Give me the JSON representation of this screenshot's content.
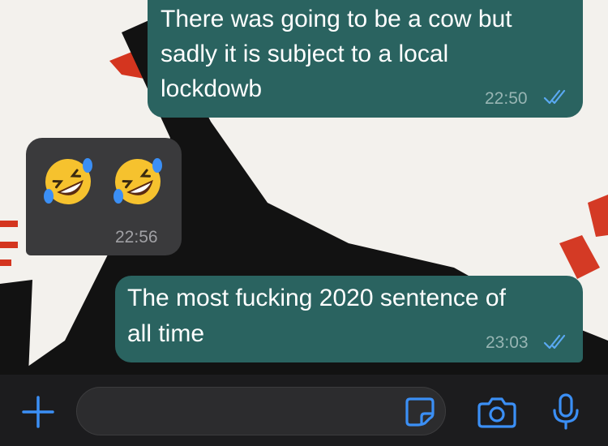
{
  "messages": [
    {
      "direction": "outgoing",
      "lines": [
        "There was going to be a cow but",
        "sadly it is subject to a local",
        "lockdowb"
      ],
      "time": "22:50",
      "status": "read"
    },
    {
      "direction": "incoming",
      "emoji": [
        "rolling-on-floor-laughing",
        "rolling-on-floor-laughing"
      ],
      "time": "22:56"
    },
    {
      "direction": "outgoing",
      "lines": [
        "The most fucking 2020 sentence of",
        "all time"
      ],
      "time": "23:03",
      "status": "read"
    }
  ],
  "composer": {
    "placeholder": ""
  },
  "icons": {
    "attach": "plus-icon",
    "sticker": "sticker-icon",
    "camera": "camera-icon",
    "mic": "microphone-icon"
  },
  "colors": {
    "outgoing_bubble": "#2a6360",
    "incoming_bubble": "#3a3a3c",
    "accent": "#3b8ff5",
    "bar": "#1c1c1e"
  }
}
